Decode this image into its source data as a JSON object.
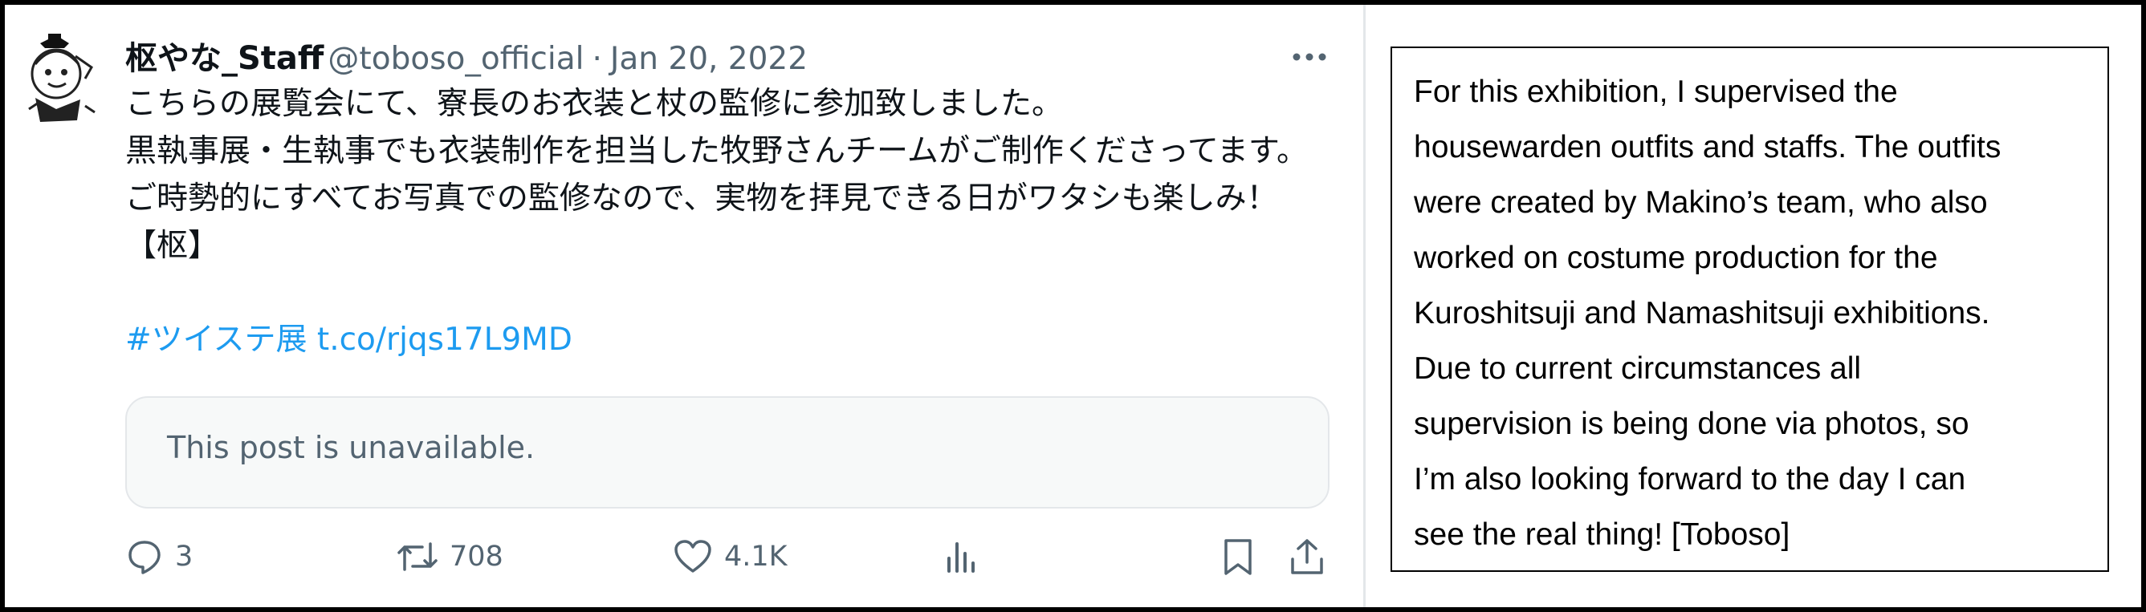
{
  "tweet": {
    "display_name": "枢やな_Staff",
    "handle": "@toboso_official",
    "separator": "·",
    "date": "Jan 20, 2022",
    "more_icon": "ellipsis-icon",
    "paragraphs": [
      "こちらの展覧会にて、寮長のお衣装と杖の監修に参加致しました。",
      "黒執事展・生執事でも衣装制作を担当した牧野さんチームがご制作くださってます。",
      "ご時勢的にすべてお写真での監修なので、実物を拝見できる日がワタシも楽しみ！【枢】"
    ],
    "hashtag": "#ツイステ展",
    "short_link": "t.co/rjqs17L9MD",
    "quote_unavailable": "This post is unavailable.",
    "actions": {
      "replies": "3",
      "reposts": "708",
      "likes": "4.1K",
      "icons": [
        "reply-icon",
        "repost-icon",
        "like-icon",
        "views-icon",
        "bookmark-icon",
        "share-icon"
      ]
    },
    "colors": {
      "text": "#0f1419",
      "muted": "#536471",
      "link": "#1d9bf0",
      "border": "#e4e7ea"
    }
  },
  "translation": {
    "text": "For this exhibition, I supervised the\nhousewarden outfits and staffs. The outfits\nwere created by Makino’s team, who also\nworked on costume production for the\nKuroshitsuji and Namashitsuji exhibitions.\nDue to current circumstances all\nsupervision is being done via photos, so\nI’m also looking forward to the day I can\nsee the real thing! [Toboso]"
  }
}
